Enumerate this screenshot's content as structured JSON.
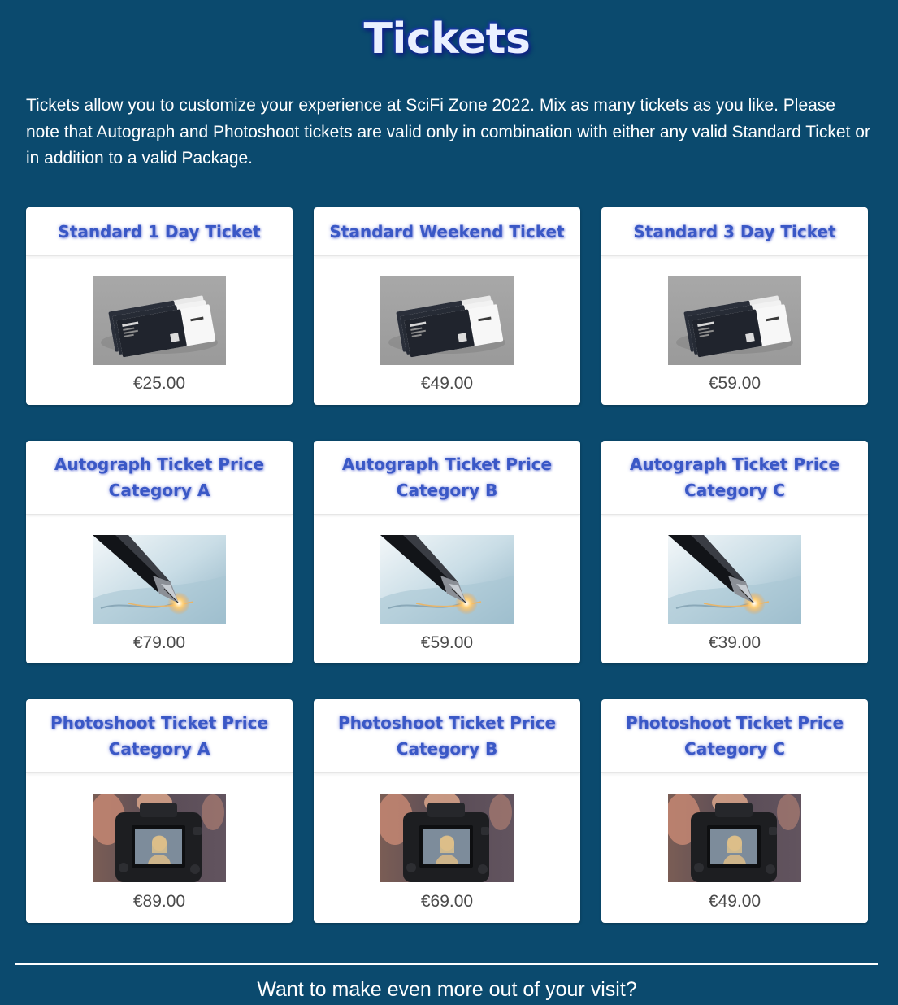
{
  "header": {
    "title": "Tickets",
    "intro": "Tickets allow you to customize your experience at SciFi Zone 2022. Mix as many tickets as you like. Please note that Autograph and Photoshoot tickets are valid only in combination with either any valid Standard Ticket or in addition to a valid Package."
  },
  "tickets": [
    {
      "title": "Standard 1 Day Ticket",
      "price": "€25.00",
      "image": "ticket-stack"
    },
    {
      "title": "Standard Weekend Ticket",
      "price": "€49.00",
      "image": "ticket-stack"
    },
    {
      "title": "Standard 3 Day Ticket",
      "price": "€59.00",
      "image": "ticket-stack"
    },
    {
      "title": "Autograph Ticket Price Category A",
      "price": "€79.00",
      "image": "fountain-pen"
    },
    {
      "title": "Autograph Ticket Price Category B",
      "price": "€59.00",
      "image": "fountain-pen"
    },
    {
      "title": "Autograph Ticket Price Category C",
      "price": "€39.00",
      "image": "fountain-pen"
    },
    {
      "title": "Photoshoot Ticket Price Category A",
      "price": "€89.00",
      "image": "camera"
    },
    {
      "title": "Photoshoot Ticket Price Category B",
      "price": "€69.00",
      "image": "camera"
    },
    {
      "title": "Photoshoot Ticket Price Category C",
      "price": "€49.00",
      "image": "camera"
    }
  ],
  "footer": {
    "prompt": "Want to make even more out of your visit?"
  },
  "colors": {
    "background": "#0b4a6e",
    "card_title": "#3a58c6",
    "price": "#4a4a4a"
  }
}
